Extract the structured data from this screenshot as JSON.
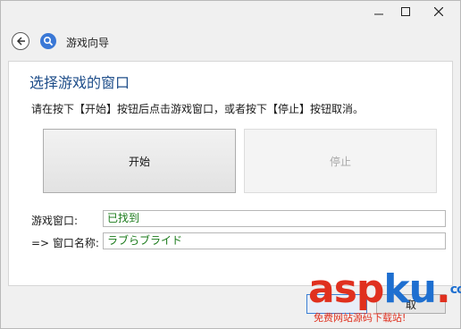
{
  "window": {
    "minimize_icon": "minimize-icon",
    "maximize_icon": "maximize-icon",
    "close_icon": "close-icon"
  },
  "header": {
    "title": "游戏向导",
    "back_icon": "back-arrow-icon",
    "app_icon": "search-wizard-icon"
  },
  "main": {
    "heading": "选择游戏的窗口",
    "instruction": "请在按下【开始】按钮后点击游戏窗口，或者按下【停止】按钮取消。",
    "start_button": "开始",
    "stop_button": "停止",
    "game_window_label": "游戏窗口:",
    "game_window_value": "已找到",
    "window_name_label": "=> 窗口名称:",
    "window_name_value": "ラブらブライド"
  },
  "footer": {
    "button_partial": "取"
  },
  "watermark": {
    "main_letters": [
      "a",
      "s",
      "p",
      "k",
      "u"
    ],
    "main_dot": ".",
    "suffix": "com",
    "subtitle": "免费网站源码下载站!",
    "colors": {
      "red": "#e0301e",
      "blue": "#1e6fd0"
    }
  },
  "colors": {
    "heading": "#1f4e8a",
    "found_text": "#1a7a1a",
    "accent": "#3a78d6"
  }
}
